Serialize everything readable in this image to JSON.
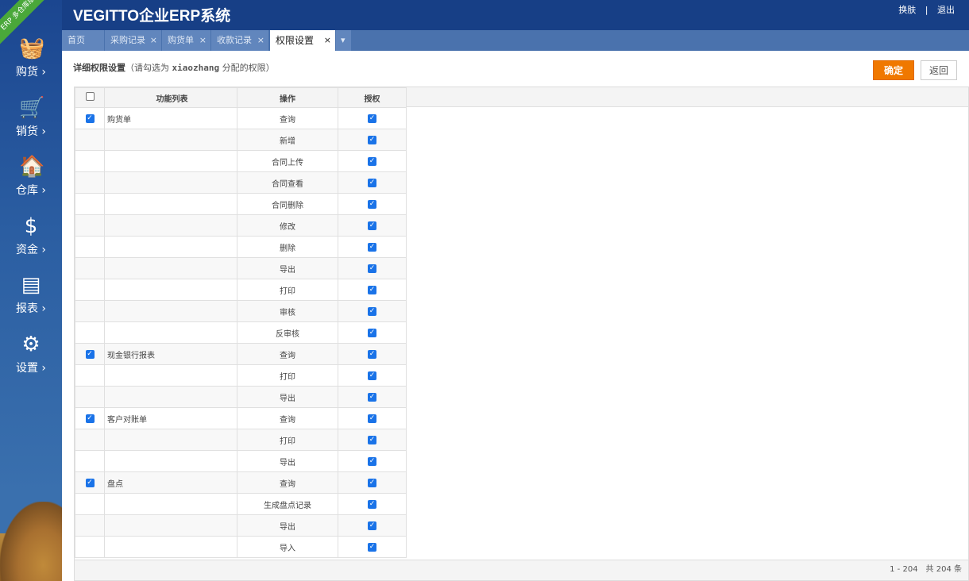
{
  "app": {
    "title": "VEGITTO企业ERP系统",
    "badge": "ERP 多仓库版",
    "links": {
      "skin": "换肤",
      "sep": "|",
      "logout": "退出"
    }
  },
  "sidebar": [
    {
      "label": "购货",
      "icon": "basket-icon",
      "glyph": "🧺"
    },
    {
      "label": "销货",
      "icon": "cart-icon",
      "glyph": "🛒"
    },
    {
      "label": "仓库",
      "icon": "warehouse-icon",
      "glyph": "🏠"
    },
    {
      "label": "资金",
      "icon": "dollar-icon",
      "glyph": "$"
    },
    {
      "label": "报表",
      "icon": "report-icon",
      "glyph": "▤"
    },
    {
      "label": "设置",
      "icon": "gear-icon",
      "glyph": "⚙"
    }
  ],
  "tabs": [
    {
      "label": "首页",
      "close": ""
    },
    {
      "label": "采购记录",
      "close": "×"
    },
    {
      "label": "购货单",
      "close": "×"
    },
    {
      "label": "收款记录",
      "close": "×"
    },
    {
      "label": "权限设置",
      "close": "×"
    },
    {
      "label": "▾",
      "close": ""
    }
  ],
  "page": {
    "title": "详细权限设置",
    "hint_pre": "（请勾选为 ",
    "user": "xiaozhang",
    "hint_post": " 分配的权限）",
    "ok": "确定",
    "back": "返回"
  },
  "table": {
    "headers": [
      "功能列表",
      "操作",
      "授权"
    ],
    "rows": [
      [
        "购货单",
        "查询"
      ],
      [
        "",
        "新增"
      ],
      [
        "",
        "合同上传"
      ],
      [
        "",
        "合同查看"
      ],
      [
        "",
        "合同删除"
      ],
      [
        "",
        "修改"
      ],
      [
        "",
        "删除"
      ],
      [
        "",
        "导出"
      ],
      [
        "",
        "打印"
      ],
      [
        "",
        "审核"
      ],
      [
        "",
        "反审核"
      ],
      [
        "现金银行报表",
        "查询"
      ],
      [
        "",
        "打印"
      ],
      [
        "",
        "导出"
      ],
      [
        "客户对账单",
        "查询"
      ],
      [
        "",
        "打印"
      ],
      [
        "",
        "导出"
      ],
      [
        "盘点",
        "查询"
      ],
      [
        "",
        "生成盘点记录"
      ],
      [
        "",
        "导出"
      ],
      [
        "",
        "导入"
      ]
    ]
  },
  "pager": "1 - 204　共 204 条"
}
